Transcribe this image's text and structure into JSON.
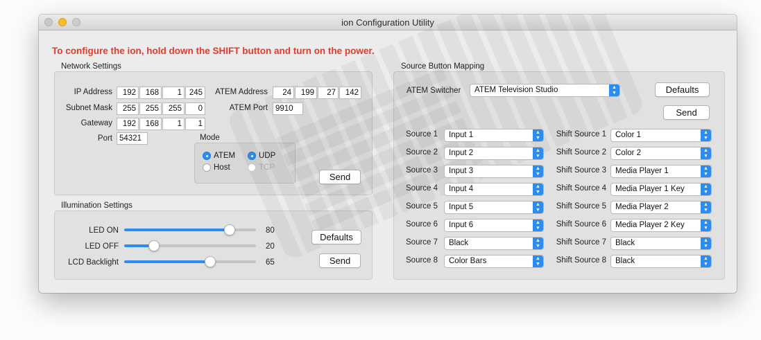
{
  "window": {
    "title": "ion Configuration Utility"
  },
  "warning": "To configure the ion, hold down the SHIFT button and turn on the power.",
  "network": {
    "section_label": "Network Settings",
    "ip_label": "IP Address",
    "ip": [
      "192",
      "168",
      "1",
      "245"
    ],
    "mask_label": "Subnet Mask",
    "mask": [
      "255",
      "255",
      "255",
      "0"
    ],
    "gateway_label": "Gateway",
    "gateway": [
      "192",
      "168",
      "1",
      "1"
    ],
    "port_label": "Port",
    "port": "54321",
    "atem_address_label": "ATEM Address",
    "atem_address": [
      "24",
      "199",
      "27",
      "142"
    ],
    "atem_port_label": "ATEM Port",
    "atem_port": "9910",
    "mode_label": "Mode",
    "mode_atem": "ATEM",
    "mode_host": "Host",
    "proto_udp": "UDP",
    "proto_tcp": "TCP",
    "send_label": "Send"
  },
  "illumination": {
    "section_label": "Illumination Settings",
    "sliders": [
      {
        "label": "LED ON",
        "value": "80"
      },
      {
        "label": "LED OFF",
        "value": "20"
      },
      {
        "label": "LCD Backlight",
        "value": "65"
      }
    ],
    "defaults_label": "Defaults",
    "send_label": "Send"
  },
  "mapping": {
    "section_label": "Source Button Mapping",
    "switcher_label": "ATEM Switcher",
    "switcher_value": "ATEM Television Studio",
    "defaults_label": "Defaults",
    "send_label": "Send",
    "rows": [
      {
        "label": "Source 1",
        "value": "Input 1",
        "shift_label": "Shift Source 1",
        "shift_value": "Color 1"
      },
      {
        "label": "Source 2",
        "value": "Input 2",
        "shift_label": "Shift Source 2",
        "shift_value": "Color 2"
      },
      {
        "label": "Source 3",
        "value": "Input 3",
        "shift_label": "Shift Source 3",
        "shift_value": "Media Player 1"
      },
      {
        "label": "Source 4",
        "value": "Input 4",
        "shift_label": "Shift Source 4",
        "shift_value": "Media Player 1 Key"
      },
      {
        "label": "Source 5",
        "value": "Input 5",
        "shift_label": "Shift Source 5",
        "shift_value": "Media Player 2"
      },
      {
        "label": "Source 6",
        "value": "Input 6",
        "shift_label": "Shift Source 6",
        "shift_value": "Media Player 2 Key"
      },
      {
        "label": "Source 7",
        "value": "Black",
        "shift_label": "Shift Source 7",
        "shift_value": "Black"
      },
      {
        "label": "Source 8",
        "value": "Color Bars",
        "shift_label": "Shift Source 8",
        "shift_value": "Black"
      }
    ]
  },
  "colors": {
    "accent": "#2d8cf0",
    "warning": "#e8382a"
  }
}
